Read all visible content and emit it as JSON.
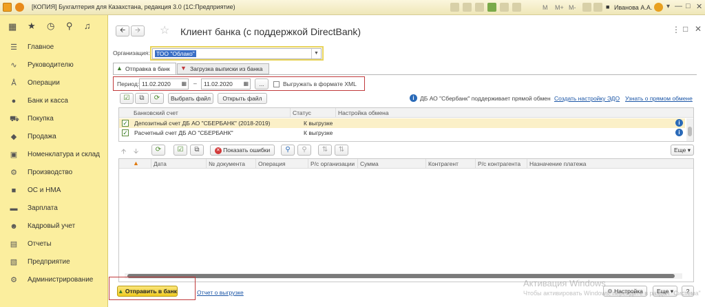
{
  "window": {
    "title": "[КОПИЯ] Бухгалтерия для Казахстана, редакция 3.0  (1С:Предприятие)",
    "user": "Иванова А.А.",
    "toolbar_labels": [
      "M",
      "M+",
      "M-"
    ]
  },
  "sidebar": {
    "items": [
      {
        "label": "Главное",
        "icon": "menu-icon"
      },
      {
        "label": "Руководителю",
        "icon": "chart-icon"
      },
      {
        "label": "Операции",
        "icon": "operations-icon"
      },
      {
        "label": "Банк и касса",
        "icon": "bank-icon"
      },
      {
        "label": "Покупка",
        "icon": "cart-icon"
      },
      {
        "label": "Продажа",
        "icon": "sale-icon"
      },
      {
        "label": "Номенклатура и склад",
        "icon": "warehouse-icon"
      },
      {
        "label": "Производство",
        "icon": "production-icon"
      },
      {
        "label": "ОС и НМА",
        "icon": "assets-icon"
      },
      {
        "label": "Зарплата",
        "icon": "salary-icon"
      },
      {
        "label": "Кадровый учет",
        "icon": "hr-icon"
      },
      {
        "label": "Отчеты",
        "icon": "reports-icon"
      },
      {
        "label": "Предприятие",
        "icon": "enterprise-icon"
      },
      {
        "label": "Администрирование",
        "icon": "gear-icon"
      }
    ]
  },
  "form": {
    "title": "Клиент банка (с поддержкой DirectBank)",
    "org_label": "Организация:",
    "org_value": "ТОО \"Облако\"",
    "tabs": [
      "Отправка в банк",
      "Загрузка выписки из банка"
    ],
    "period_label": "Период:",
    "date_from": "11.02.2020",
    "date_to": "11.02.2020",
    "dash": "–",
    "ellipsis": "...",
    "xml_checkbox_label": "Выгружать в формате XML",
    "info_text": "ДБ АО \"Сбербанк\" поддерживает прямой обмен",
    "link_setup": "Создать настройку ЭДО",
    "link_learn": "Узнать о прямом обмене",
    "btn_select_file": "Выбрать файл",
    "btn_open_file": "Открыть файл",
    "accounts_columns": [
      "Банковский счет",
      "Статус",
      "Настройка обмена"
    ],
    "accounts": [
      {
        "name": "Депозитный  счет  ДБ АО \"СБЕРБАНК\" (2018-2019)",
        "status": "К выгрузке",
        "checked": true
      },
      {
        "name": "Расчетный счет  ДБ АО \"СБЕРБАНК\"",
        "status": "К выгрузке",
        "checked": true
      }
    ],
    "btn_show_errors": "Показать ошибки",
    "btn_more": "Еще",
    "docs_columns": [
      "Дата",
      "№ документа",
      "Операция",
      "Р/с организации",
      "Сумма",
      "Контрагент",
      "Р/с контрагента",
      "Назначение платежа"
    ],
    "btn_send": "Отправить в банк",
    "link_report": "Отчет о выгрузке",
    "btn_settings": "Настройка",
    "btn_more2": "Еще",
    "btn_help": "?"
  },
  "watermark": {
    "line1": "Активация Windows",
    "line2": "Чтобы активировать Windows, перейдите в раздел \"Система\""
  },
  "colors": {
    "sidebar_bg": "#fbee9e",
    "accent_red": "#c0393b",
    "send_button": "#f5d33a",
    "link": "#1a55a6"
  }
}
